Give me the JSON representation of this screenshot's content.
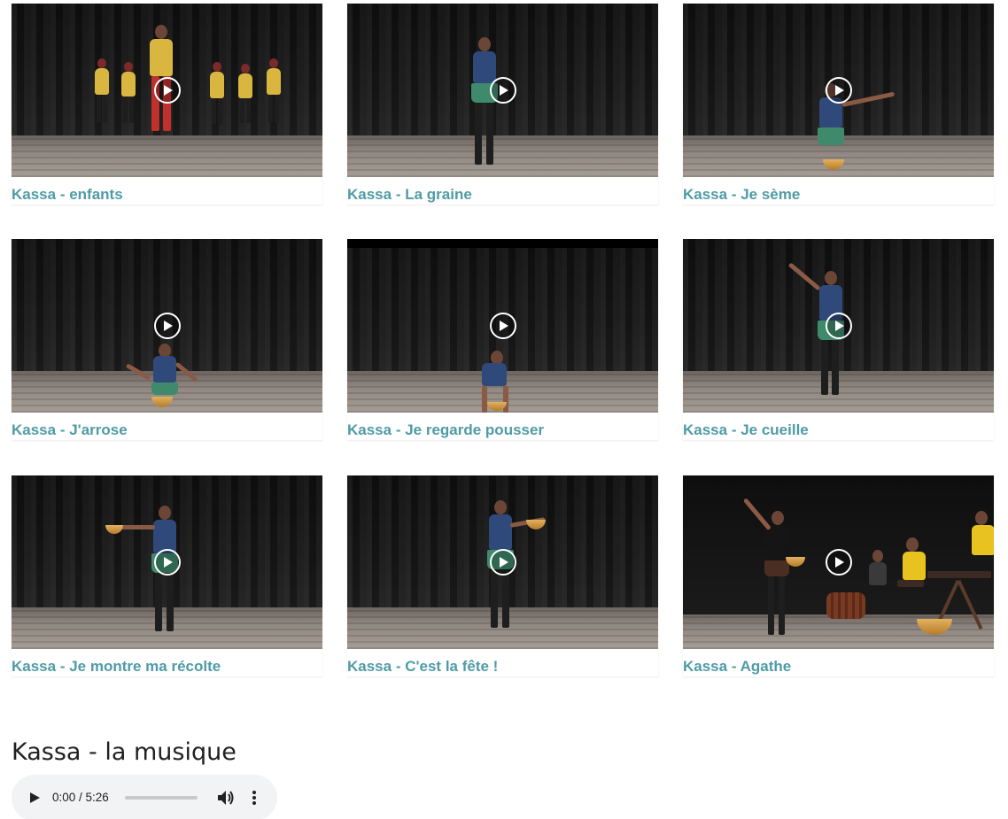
{
  "videos": [
    {
      "title": "Kassa - enfants",
      "scene": "group"
    },
    {
      "title": "Kassa - La graine",
      "scene": "standing"
    },
    {
      "title": "Kassa - Je sème",
      "scene": "kneel-arm"
    },
    {
      "title": "Kassa - J'arrose",
      "scene": "kneel"
    },
    {
      "title": "Kassa - Je regarde pousser",
      "scene": "crouch"
    },
    {
      "title": "Kassa - Je cueille",
      "scene": "reach-up"
    },
    {
      "title": "Kassa - Je montre ma récolte",
      "scene": "offer-left"
    },
    {
      "title": "Kassa - C'est la fête !",
      "scene": "offer-right"
    },
    {
      "title": "Kassa - Agathe",
      "scene": "band"
    }
  ],
  "audio": {
    "title": "Kassa - la musique",
    "time": "0:00 / 5:26",
    "progress": 0
  },
  "colors": {
    "link": "#4f9ba6",
    "heading": "#212121",
    "player_bg": "#f1f3f4"
  },
  "icons": {
    "play_overlay": "play-circle-icon",
    "audio_play": "play-icon",
    "volume": "volume-icon",
    "more": "more-vert-icon"
  }
}
